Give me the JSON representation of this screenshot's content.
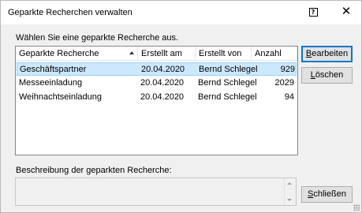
{
  "window": {
    "title": "Geparkte Recherchen verwalten",
    "help_label": "?",
    "close_label": "✕"
  },
  "prompt": "Wählen Sie eine geparkte Recherche aus.",
  "list": {
    "columns": [
      "Geparkte Recherche",
      "Erstellt am",
      "Erstellt von",
      "Anzahl"
    ],
    "rows": [
      {
        "name": "Geschäftspartner",
        "date": "20.04.2020",
        "author": "Bernd Schlegel",
        "count": "929",
        "selected": true
      },
      {
        "name": "Messeeinladung",
        "date": "20.04.2020",
        "author": "Bernd Schlegel",
        "count": "2029",
        "selected": false
      },
      {
        "name": "Weihnachtseinladung",
        "date": "20.04.2020",
        "author": "Bernd Schlegel",
        "count": "94",
        "selected": false
      }
    ]
  },
  "buttons": {
    "edit_mnemonic": "B",
    "edit_rest": "earbeiten",
    "delete_mnemonic": "L",
    "delete_rest": "öschen",
    "close_mnemonic": "S",
    "close_rest": "chließen"
  },
  "description": {
    "label": "Beschreibung der geparkten Recherche:",
    "text": ""
  }
}
